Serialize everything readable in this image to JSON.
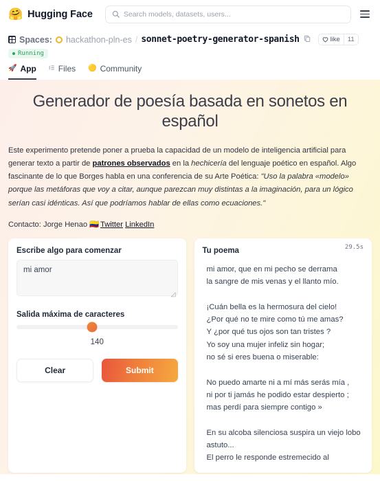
{
  "navbar": {
    "brand_logo": "hugging-face-emoji",
    "brand_name": "Hugging Face",
    "search_placeholder": "Search models, datasets, users...",
    "search_value": "",
    "search_icon": "search-icon",
    "menu_icon": "hamburger-menu-icon"
  },
  "space_header": {
    "spaces_label": "Spaces:",
    "org_name": "hackathon-pln-es",
    "path_separator": "/",
    "repo_name": "sonnet-poetry-generator-spanish",
    "copy_icon": "copy-icon",
    "like_label": "like",
    "like_icon": "heart-icon",
    "like_count": "11",
    "status": "Running"
  },
  "tabs": [
    {
      "label": "App",
      "icon": "rocket-icon",
      "active": true
    },
    {
      "label": "Files",
      "icon": "files-icon",
      "active": false
    },
    {
      "label": "Community",
      "icon": "speech-bubble-icon",
      "active": false
    }
  ],
  "app": {
    "title": "Generador de poesía basada en sonetos en español",
    "desc_part1": "Este experimento pretende poner a prueba la capacidad de un modelo de inteligencia artificial para generar texto a partir de ",
    "desc_link": "patrones observados",
    "desc_part2": " en la ",
    "desc_em1": "hechicería",
    "desc_part3": " del lenguaje poético en español. Algo fascinante de lo que Borges habla en una conferencia de su Arte Poética: ",
    "desc_quote": "\"Uso la palabra «modelo» porque las metáforas que voy a citar, aunque parezcan muy distintas a la imaginación, para un lógico serían casi idénticas. Así que podríamos hablar de ellas como ecuaciones.\"",
    "contact_label": "Contacto: Jorge Henao",
    "contact_flag": "🇨🇴",
    "contact_twitter": "Twitter",
    "contact_linkedin": "LinkedIn"
  },
  "input_panel": {
    "textarea_label": "Escribe algo para comenzar",
    "textarea_value": "mi amor",
    "textarea_placeholder": "",
    "slider_label": "Salida máxima de caracteres",
    "slider_value": "140",
    "clear_label": "Clear",
    "submit_label": "Submit"
  },
  "output_panel": {
    "title": "Tu poema",
    "timer": "29.5s",
    "poem": "mi amor, que en mi pecho se derrama\nla sangre de mis venas y el llanto mío.\n\n¡Cuán bella es la hermosura del cielo!\n¿Por qué no te mire como tú me amas?\nY ¿por qué tus ojos son tan tristes ?\nYo soy una mujer infeliz sin hogar;\nno sé si eres buena o miserable:\n\nNo puedo amarte ni a mí más serás mía ,\nni por ti jamás he podido estar despierto ;\nmas perdí para siempre contigo »\n\nEn su alcoba silenciosa suspira un viejo lobo\nastuto...\nEl perro le responde estremecido al"
  },
  "colors": {
    "accent_orange": "#ef7f3c",
    "submit_gradient_start": "#e8553c",
    "submit_gradient_end": "#f5a93f",
    "status_green": "#2f9e5f",
    "bg_gradient_start": "#fdeeea",
    "bg_gradient_end": "#fdf8cc"
  }
}
